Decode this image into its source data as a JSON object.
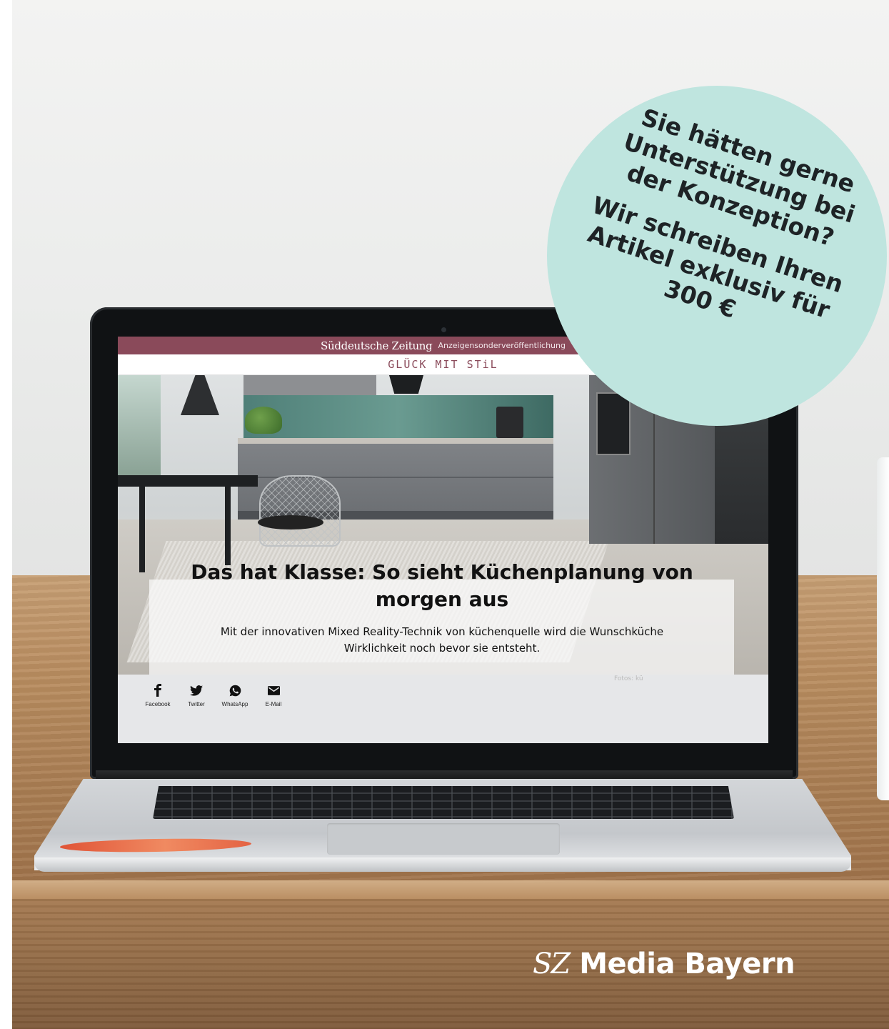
{
  "promo": {
    "question": "Sie hätten gerne Unterstützung bei der Konzeption?",
    "offer": "Wir schreiben Ihren Artikel exklusiv für 300 €",
    "bg_color": "#bfe5df"
  },
  "screen": {
    "masthead": {
      "logo": "Süddeutsche Zeitung",
      "tag": "Anzeigensonderveröffentlichung",
      "bg_color": "#8a4a5a"
    },
    "section_title": "GLÜCK MIT STiL",
    "hero": {
      "title": "Das hat Klasse: So sieht Küchenplanung von morgen aus",
      "subtitle": "Mit der innovativen Mixed Reality-Technik von küchenquelle wird die Wunschküche Wirklichkeit noch bevor sie entsteht.",
      "credit": "Fotos: kü"
    },
    "share": [
      {
        "label": "Facebook",
        "icon": "facebook-icon"
      },
      {
        "label": "Twitter",
        "icon": "twitter-icon"
      },
      {
        "label": "WhatsApp",
        "icon": "whatsapp-icon"
      },
      {
        "label": "E-Mail",
        "icon": "email-icon"
      }
    ]
  },
  "brand": {
    "prefix": "SZ",
    "name": "Media Bayern"
  }
}
